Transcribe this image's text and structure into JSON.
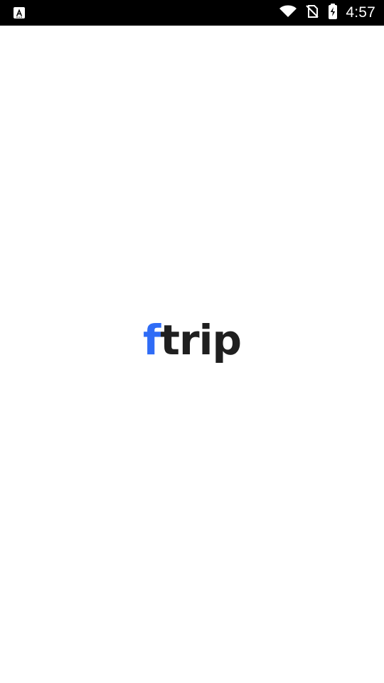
{
  "status_bar": {
    "time": "4:57",
    "icons": [
      "accessibility-a-icon",
      "wifi-icon",
      "no-sim-icon",
      "battery-charging-icon"
    ]
  },
  "splash": {
    "logo": {
      "prefix": "f",
      "suffix": "trip"
    }
  },
  "colors": {
    "status_bar_bg": "#000000",
    "background": "#ffffff",
    "logo_accent": "#2f6cf6",
    "logo_text": "#1f1f1f"
  }
}
